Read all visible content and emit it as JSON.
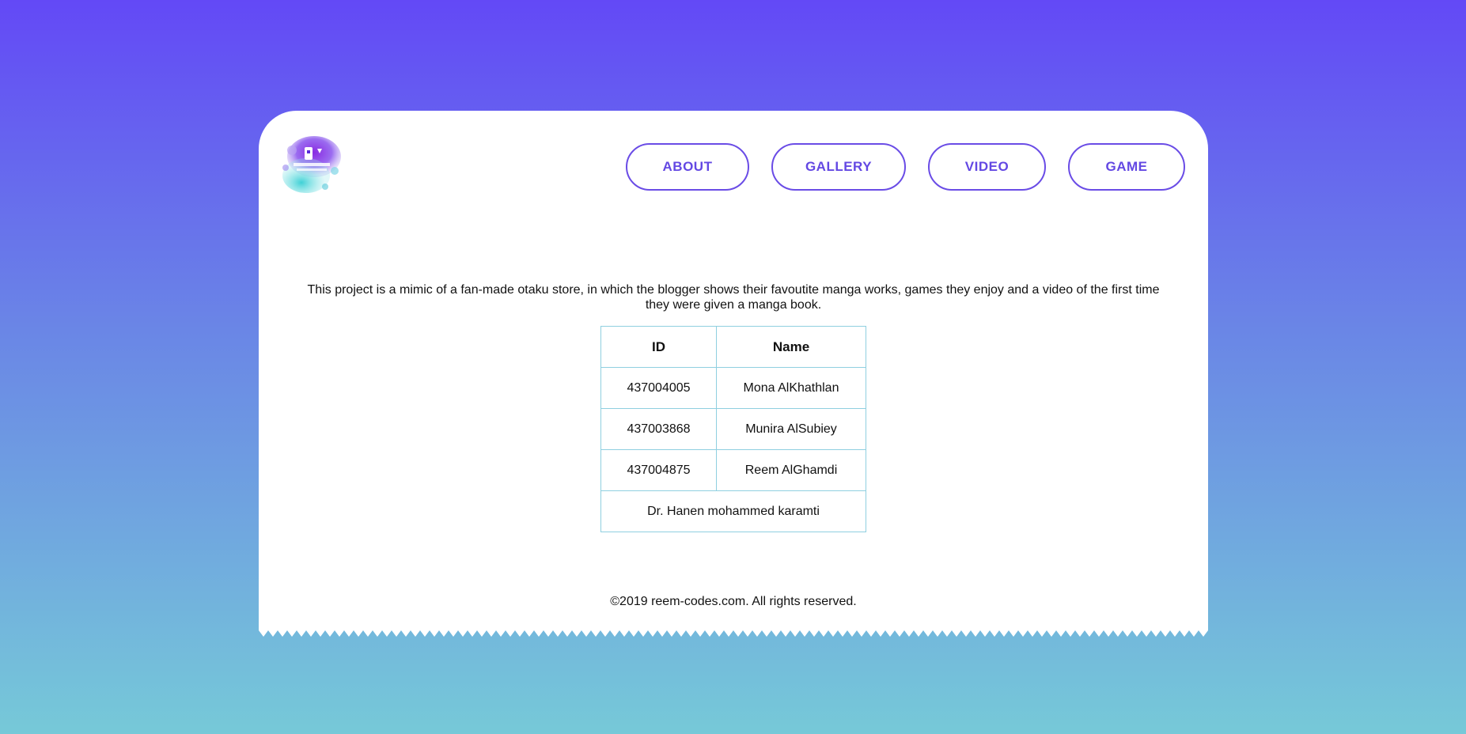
{
  "nav": {
    "items": [
      {
        "label": "ABOUT"
      },
      {
        "label": "GALLERY"
      },
      {
        "label": "VIDEO"
      },
      {
        "label": "GAME"
      }
    ]
  },
  "main": {
    "description": "This project is a mimic of a fan-made otaku store, in which the blogger shows their favoutite manga works, games they enjoy and a video of the first time they were given a manga book.",
    "table": {
      "headers": [
        "ID",
        "Name"
      ],
      "rows": [
        [
          "437004005",
          "Mona AlKhathlan"
        ],
        [
          "437003868",
          "Munira AlSubiey"
        ],
        [
          "437004875",
          "Reem AlGhamdi"
        ]
      ],
      "footer_row": "Dr. Hanen mohammed karamti"
    }
  },
  "footer": {
    "copyright": "©2019 reem-codes.com. All rights reserved."
  },
  "colors": {
    "accent": "#6348e3",
    "table_border": "#8fcfe0",
    "bg_top": "#6349f6",
    "bg_bottom": "#76c9d8"
  }
}
